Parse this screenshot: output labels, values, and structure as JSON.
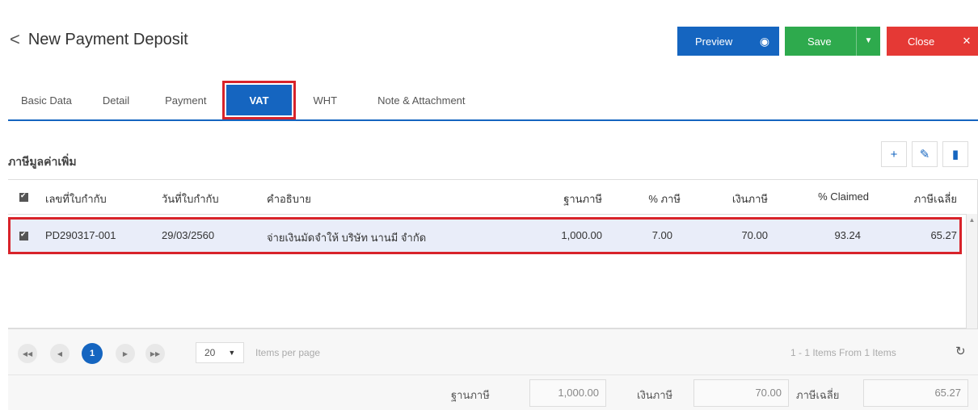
{
  "header": {
    "back_glyph": "<",
    "title": "New Payment Deposit",
    "preview_label": "Preview",
    "save_label": "Save",
    "close_label": "Close"
  },
  "tabs": [
    {
      "label": "Basic Data"
    },
    {
      "label": "Detail"
    },
    {
      "label": "Payment"
    },
    {
      "label": "VAT",
      "active": true
    },
    {
      "label": "WHT"
    },
    {
      "label": "Note & Attachment"
    }
  ],
  "section": {
    "title": "ภาษีมูลค่าเพิ่ม"
  },
  "table": {
    "columns": [
      "เลขที่ใบกำกับ",
      "วันที่ใบกำกับ",
      "คำอธิบาย",
      "ฐานภาษี",
      "% ภาษี",
      "เงินภาษี",
      "% Claimed",
      "ภาษีเฉลี่ย"
    ],
    "rows": [
      {
        "invoice_no": "PD290317-001",
        "invoice_date": "29/03/2560",
        "description": "จ่ายเงินมัดจำให้ บริษัท นานมี จำกัด",
        "tax_base": "1,000.00",
        "tax_pct": "7.00",
        "tax_amount": "70.00",
        "claimed_pct": "93.24",
        "avg_tax": "65.27"
      }
    ]
  },
  "pager": {
    "current_page": "1",
    "page_size": "20",
    "items_per_page_label": "Items per page",
    "summary": "1 - 1 Items From 1 Items"
  },
  "totals": {
    "tax_base_label": "ฐานภาษี",
    "tax_base_value": "1,000.00",
    "tax_amount_label": "เงินภาษี",
    "tax_amount_value": "70.00",
    "avg_tax_label": "ภาษีเฉลี่ย",
    "avg_tax_value": "65.27"
  },
  "colors": {
    "primary": "#1565c0",
    "success": "#2eaa4d",
    "danger": "#e53935",
    "highlight": "#d8232a"
  }
}
